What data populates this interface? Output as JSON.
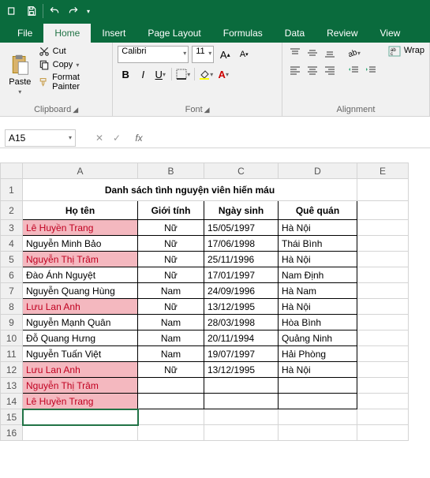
{
  "qat": {
    "save": "save-icon",
    "undo": "undo-icon",
    "redo": "redo-icon"
  },
  "tabs": [
    "File",
    "Home",
    "Insert",
    "Page Layout",
    "Formulas",
    "Data",
    "Review",
    "View"
  ],
  "active_tab": "Home",
  "ribbon": {
    "clipboard": {
      "label": "Clipboard",
      "paste": "Paste",
      "cut": "Cut",
      "copy": "Copy",
      "format_painter": "Format Painter"
    },
    "font": {
      "label": "Font",
      "name": "Calibri",
      "size": "11"
    },
    "alignment": {
      "label": "Alignment",
      "wrap": "Wrap"
    }
  },
  "namebox": "A15",
  "formula": "",
  "columns": [
    "A",
    "B",
    "C",
    "D",
    "E"
  ],
  "title": "Danh sách tình nguyện viên hiến máu",
  "headers": [
    "Họ tên",
    "Giới tính",
    "Ngày sinh",
    "Quê quán"
  ],
  "rows": [
    {
      "n": 3,
      "hl": true,
      "a": "Lê Huyền Trang",
      "b": "Nữ",
      "c": "15/05/1997",
      "d": "Hà Nội"
    },
    {
      "n": 4,
      "hl": false,
      "a": "Nguyễn Minh Bảo",
      "b": "Nữ",
      "c": "17/06/1998",
      "d": "Thái Bình"
    },
    {
      "n": 5,
      "hl": true,
      "a": "Nguyễn Thị Trâm",
      "b": "Nữ",
      "c": "25/11/1996",
      "d": "Hà Nội"
    },
    {
      "n": 6,
      "hl": false,
      "a": "Đào Ánh Nguyệt",
      "b": "Nữ",
      "c": "17/01/1997",
      "d": "Nam Định"
    },
    {
      "n": 7,
      "hl": false,
      "a": "Nguyễn Quang Hùng",
      "b": "Nam",
      "c": "24/09/1996",
      "d": "Hà Nam"
    },
    {
      "n": 8,
      "hl": true,
      "a": "Lưu Lan Anh",
      "b": "Nữ",
      "c": "13/12/1995",
      "d": "Hà Nội"
    },
    {
      "n": 9,
      "hl": false,
      "a": "Nguyễn Mạnh Quân",
      "b": "Nam",
      "c": "28/03/1998",
      "d": "Hòa Bình"
    },
    {
      "n": 10,
      "hl": false,
      "a": "Đỗ Quang Hưng",
      "b": "Nam",
      "c": "20/11/1994",
      "d": "Quảng Ninh"
    },
    {
      "n": 11,
      "hl": false,
      "a": "Nguyễn Tuấn Việt",
      "b": "Nam",
      "c": "19/07/1997",
      "d": "Hải Phòng"
    },
    {
      "n": 12,
      "hl": true,
      "a": "Lưu Lan Anh",
      "b": "Nữ",
      "c": "13/12/1995",
      "d": "Hà Nội"
    },
    {
      "n": 13,
      "hl": true,
      "a": "Nguyễn Thị Trâm",
      "b": "",
      "c": "",
      "d": ""
    },
    {
      "n": 14,
      "hl": true,
      "a": "Lê Huyền Trang",
      "b": "",
      "c": "",
      "d": ""
    }
  ],
  "empty_rows": [
    15,
    16
  ],
  "selected": "A15"
}
